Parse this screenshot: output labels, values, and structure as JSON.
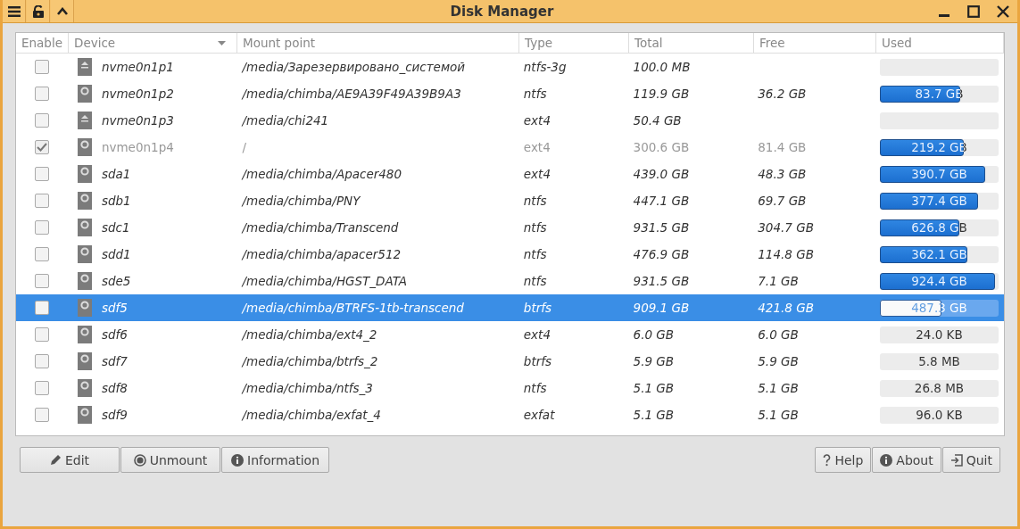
{
  "window": {
    "title": "Disk Manager"
  },
  "columns": [
    "Enable",
    "Device",
    "Mount point",
    "Type",
    "Total",
    "Free",
    "Used"
  ],
  "rows": [
    {
      "enabled": false,
      "disabled": false,
      "selected": false,
      "kind": "eject",
      "device": "nvme0n1p1",
      "mount": "/media/Зарезервировано_системой",
      "type": "ntfs-3g",
      "total": "100.0 MB"
    },
    {
      "enabled": false,
      "disabled": false,
      "selected": false,
      "kind": "disk",
      "device": "nvme0n1p2",
      "mount": "/media/chimba/AE9A39F49A39B9A3",
      "type": "ntfs",
      "total": "119.9 GB",
      "free": "36.2 GB",
      "used": "83.7 GB",
      "level": 0.68
    },
    {
      "enabled": false,
      "disabled": false,
      "selected": false,
      "kind": "eject",
      "device": "nvme0n1p3",
      "mount": "/media/chi241",
      "type": "ext4",
      "total": "50.4 GB"
    },
    {
      "enabled": true,
      "disabled": true,
      "selected": false,
      "kind": "disk",
      "device": "nvme0n1p4",
      "mount": "/",
      "type": "ext4",
      "total": "300.6 GB",
      "free": "81.4 GB",
      "used": "219.2 GB",
      "level": 0.71
    },
    {
      "enabled": false,
      "disabled": false,
      "selected": false,
      "kind": "disk",
      "device": "sda1",
      "mount": "/media/chimba/Apacer480",
      "type": "ext4",
      "total": "439.0 GB",
      "free": "48.3 GB",
      "used": "390.7 GB",
      "level": 0.89
    },
    {
      "enabled": false,
      "disabled": false,
      "selected": false,
      "kind": "disk",
      "device": "sdb1",
      "mount": "/media/chimba/PNY",
      "type": "ntfs",
      "total": "447.1 GB",
      "free": "69.7 GB",
      "used": "377.4 GB",
      "level": 0.83
    },
    {
      "enabled": false,
      "disabled": false,
      "selected": false,
      "kind": "disk",
      "device": "sdc1",
      "mount": "/media/chimba/Transcend",
      "type": "ntfs",
      "total": "931.5 GB",
      "free": "304.7 GB",
      "used": "626.8 GB",
      "level": 0.67
    },
    {
      "enabled": false,
      "disabled": false,
      "selected": false,
      "kind": "disk",
      "device": "sdd1",
      "mount": "/media/chimba/apacer512",
      "type": "ntfs",
      "total": "476.9 GB",
      "free": "114.8 GB",
      "used": "362.1 GB",
      "level": 0.74
    },
    {
      "enabled": false,
      "disabled": false,
      "selected": false,
      "kind": "disk",
      "device": "sde5",
      "mount": "/media/chimba/HGST_DATA",
      "type": "ntfs",
      "total": "931.5 GB",
      "free": "7.1 GB",
      "used": "924.4 GB",
      "level": 0.97
    },
    {
      "enabled": false,
      "disabled": false,
      "selected": true,
      "kind": "disk",
      "device": "sdf5",
      "mount": "/media/chimba/BTRFS-1tb-transcend",
      "type": "btrfs",
      "total": "909.1 GB",
      "free": "421.8 GB",
      "used": "487.3 GB",
      "level": 0.52
    },
    {
      "enabled": false,
      "disabled": false,
      "selected": false,
      "kind": "disk",
      "device": "sdf6",
      "mount": "/media/chimba/ext4_2",
      "type": "ext4",
      "total": "6.0 GB",
      "free": "6.0 GB",
      "used": "24.0 KB"
    },
    {
      "enabled": false,
      "disabled": false,
      "selected": false,
      "kind": "disk",
      "device": "sdf7",
      "mount": "/media/chimba/btrfs_2",
      "type": "btrfs",
      "total": "5.9 GB",
      "free": "5.9 GB",
      "used": "5.8 MB"
    },
    {
      "enabled": false,
      "disabled": false,
      "selected": false,
      "kind": "disk",
      "device": "sdf8",
      "mount": "/media/chimba/ntfs_3",
      "type": "ntfs",
      "total": "5.1 GB",
      "free": "5.1 GB",
      "used": "26.8 MB"
    },
    {
      "enabled": false,
      "disabled": false,
      "selected": false,
      "kind": "disk",
      "device": "sdf9",
      "mount": "/media/chimba/exfat_4",
      "type": "exfat",
      "total": "5.1 GB",
      "free": "5.1 GB",
      "used": "96.0 KB"
    }
  ],
  "left_buttons": [
    {
      "kind": "edit",
      "label": "Edit"
    },
    {
      "kind": "unmount",
      "label": "Unmount"
    },
    {
      "kind": "info",
      "label": "Information"
    }
  ],
  "right_buttons": [
    {
      "kind": "help",
      "label": "Help"
    },
    {
      "kind": "info",
      "label": "About"
    },
    {
      "kind": "quit",
      "label": "Quit"
    }
  ]
}
